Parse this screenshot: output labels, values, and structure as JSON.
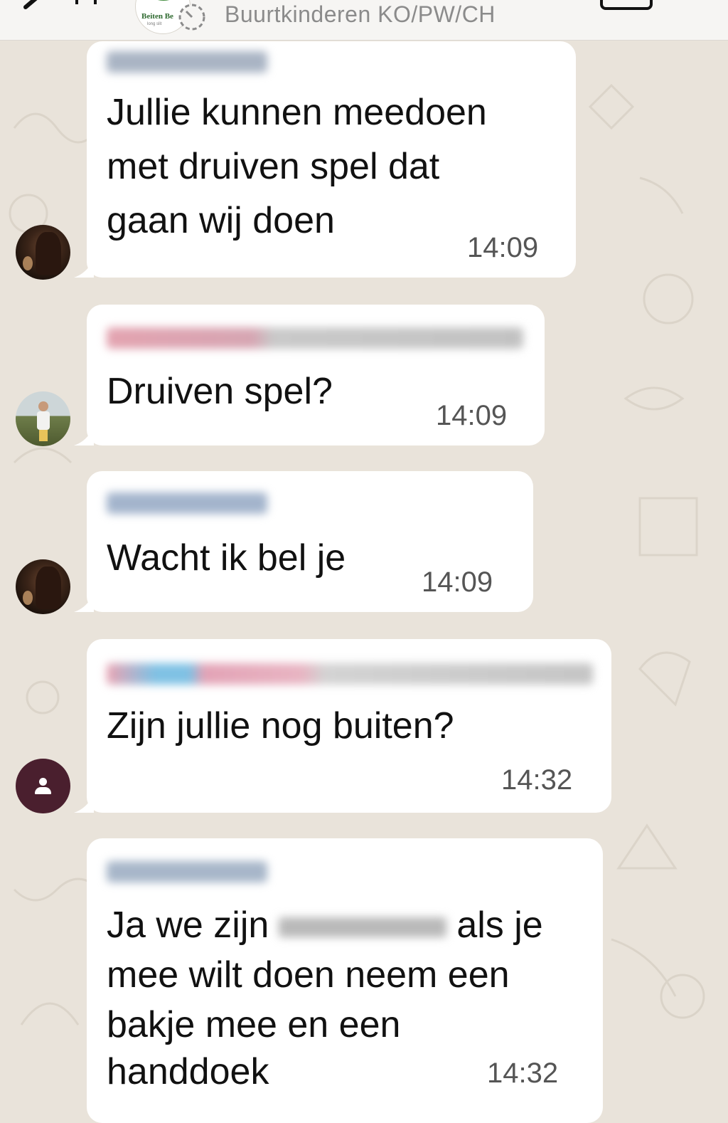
{
  "header": {
    "group_name": "Buurtkinderen KO/PW/CH",
    "group_avatar_logo": "Beiten Be",
    "group_avatar_sub": "long slit",
    "back_icon": "chevron-left-icon",
    "video_icon": "video-call-icon"
  },
  "messages": [
    {
      "avatar": "photo-dark",
      "sender_redacted": true,
      "lines": [
        "Jullie kunnen meedoen",
        "met druiven spel dat",
        "gaan wij doen"
      ],
      "time": "14:09"
    },
    {
      "avatar": "photo-field",
      "sender_redacted": true,
      "lines": [
        "Druiven spel?"
      ],
      "time": "14:09"
    },
    {
      "avatar": "photo-dark",
      "sender_redacted": true,
      "lines": [
        "Wacht ik bel je"
      ],
      "time": "14:09"
    },
    {
      "avatar": "default-person-icon",
      "sender_redacted": true,
      "lines": [
        "Zijn jullie nog buiten?"
      ],
      "time": "14:32"
    },
    {
      "avatar": "none",
      "sender_redacted": true,
      "line1_before": "Ja we zijn",
      "line1_after": "als je",
      "lines": [
        "mee wilt doen neem een",
        "bakje mee en een",
        "handdoek"
      ],
      "time": "14:32"
    }
  ],
  "colors": {
    "background": "#e9e3da",
    "bubble": "#ffffff",
    "text": "#111111",
    "timestamp": "#555555",
    "header_text": "#8b8b8b"
  }
}
